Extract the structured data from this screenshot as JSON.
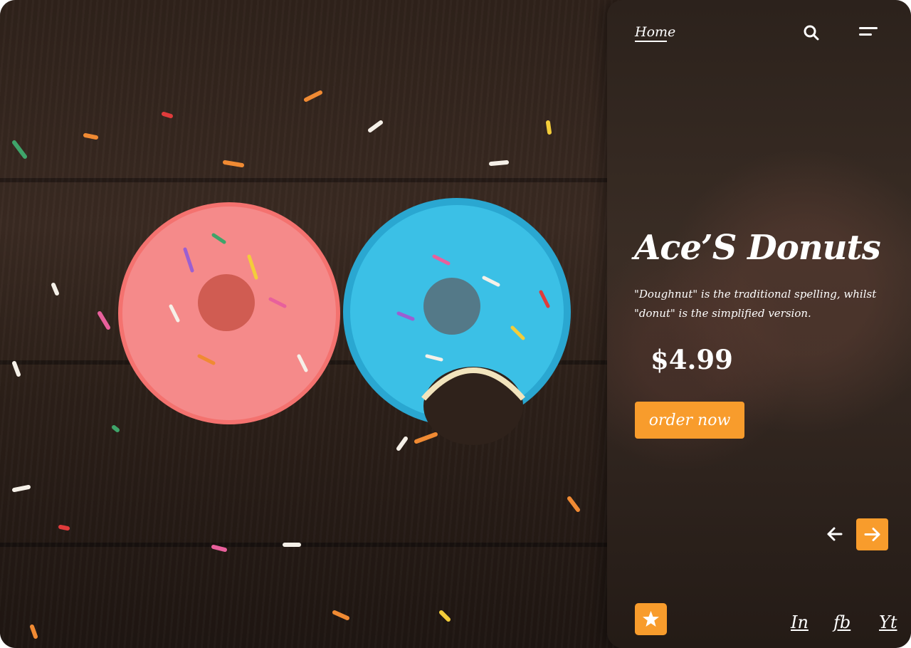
{
  "nav": {
    "home_label": "Home",
    "search_icon": "search-icon",
    "menu_icon": "menu-icon"
  },
  "product": {
    "title": "Ace’S Donuts",
    "description": "\"Doughnut\" is the traditional spelling, whilst \"donut\" is the simplified version.",
    "price": "$4.99",
    "order_label": "order now"
  },
  "carousel": {
    "prev_icon": "arrow-left-icon",
    "next_icon": "arrow-right-icon"
  },
  "footer": {
    "favorite_icon": "star-icon",
    "social": {
      "linkedin": "In",
      "facebook": "fb",
      "youtube": "Yt"
    }
  },
  "colors": {
    "accent": "#f89c2c",
    "text": "#ffffff"
  }
}
